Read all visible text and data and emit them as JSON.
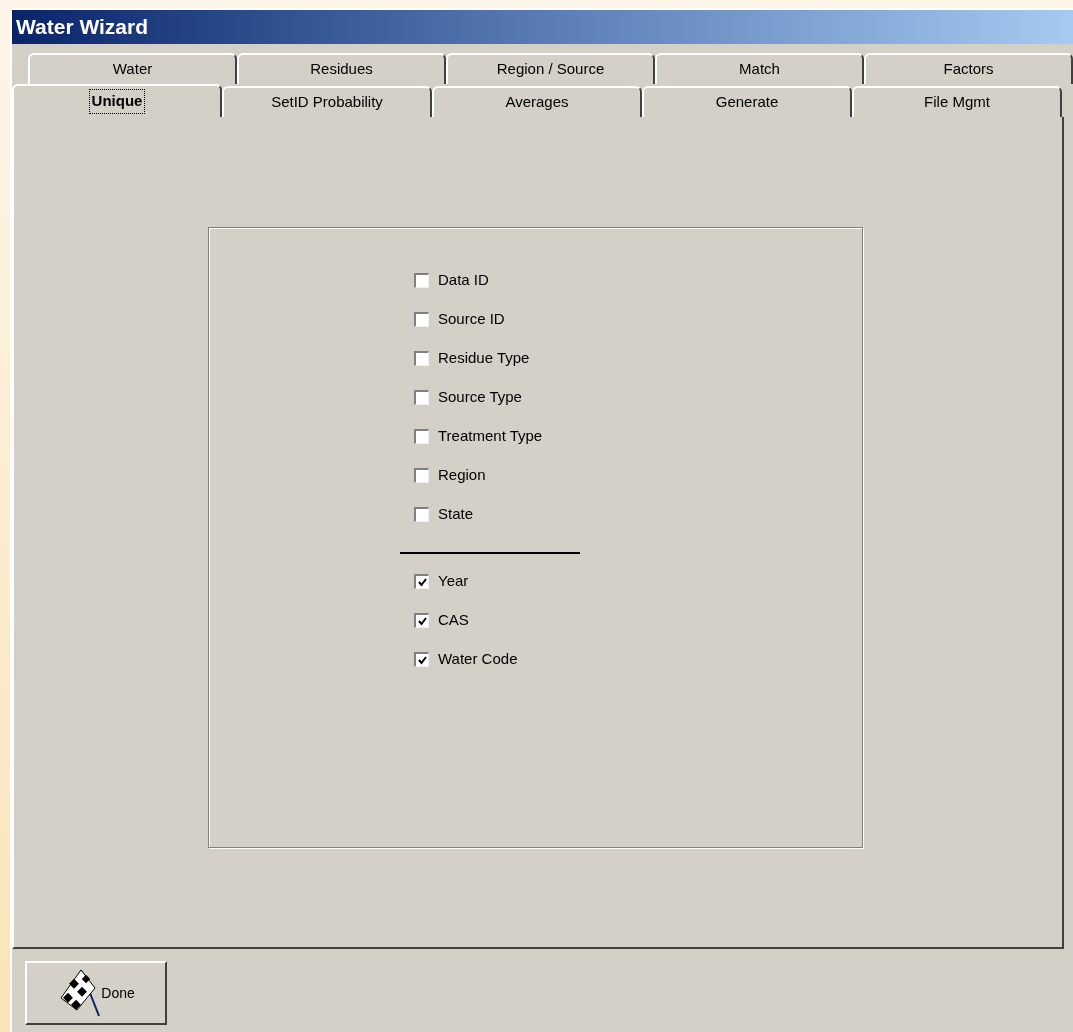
{
  "window": {
    "title": "Water Wizard"
  },
  "tab_rows": [
    {
      "tabs": [
        {
          "label": "Water",
          "selected": false
        },
        {
          "label": "Residues",
          "selected": false
        },
        {
          "label": "Region / Source",
          "selected": false
        },
        {
          "label": "Match",
          "selected": false
        },
        {
          "label": "Factors",
          "selected": false
        }
      ]
    },
    {
      "tabs": [
        {
          "label": "Unique",
          "selected": true
        },
        {
          "label": "SetID Probability",
          "selected": false
        },
        {
          "label": "Averages",
          "selected": false
        },
        {
          "label": "Generate",
          "selected": false
        },
        {
          "label": "File Mgmt",
          "selected": false
        }
      ]
    }
  ],
  "options": [
    {
      "kind": "checkbox",
      "label": "Data ID",
      "checked": false
    },
    {
      "kind": "checkbox",
      "label": "Source ID",
      "checked": false
    },
    {
      "kind": "checkbox",
      "label": "Residue Type",
      "checked": false
    },
    {
      "kind": "checkbox",
      "label": "Source Type",
      "checked": false
    },
    {
      "kind": "checkbox",
      "label": "Treatment Type",
      "checked": false
    },
    {
      "kind": "checkbox",
      "label": "Region",
      "checked": false
    },
    {
      "kind": "checkbox",
      "label": "State",
      "checked": false
    },
    {
      "kind": "divider"
    },
    {
      "kind": "checkbox",
      "label": "Year",
      "checked": true
    },
    {
      "kind": "checkbox",
      "label": "CAS",
      "checked": true
    },
    {
      "kind": "checkbox",
      "label": "Water Code",
      "checked": true
    }
  ],
  "done_button": {
    "label": "Done"
  }
}
